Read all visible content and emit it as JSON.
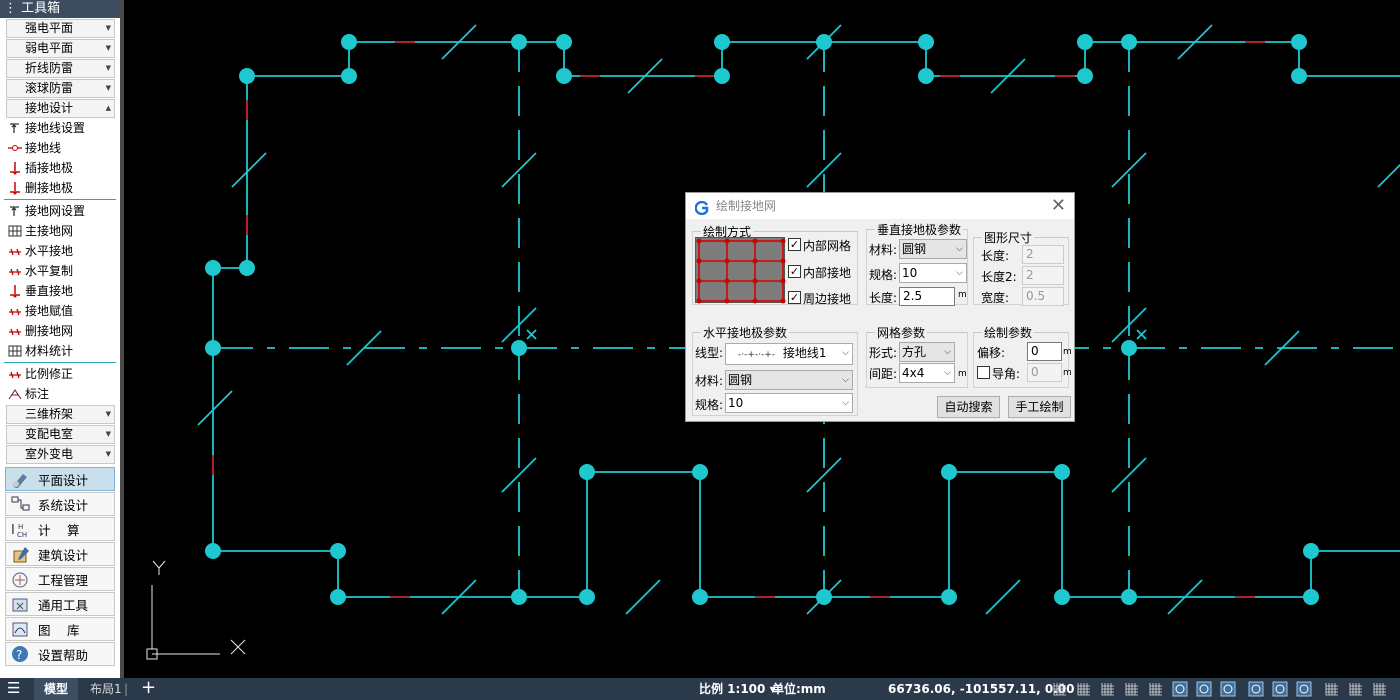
{
  "toolbox": {
    "title": "工具箱",
    "combos": [
      "强电平面",
      "弱电平面",
      "折线防雷",
      "滚球防雷",
      "接地设计"
    ],
    "items1": [
      "接地线设置",
      "接地线",
      "插接地极",
      "删接地极"
    ],
    "items2": [
      "接地网设置",
      "主接地网",
      "水平接地",
      "水平复制",
      "垂直接地",
      "接地赋值",
      "删接地网",
      "材料统计"
    ],
    "items3": [
      "比例修正",
      "标注"
    ],
    "combos2": [
      "三维桥架",
      "变配电室",
      "室外变电"
    ],
    "bigbuttons": [
      "平面设计",
      "系统设计",
      "计　 算",
      "建筑设计",
      "工程管理",
      "通用工具",
      "图　 库",
      "设置帮助"
    ],
    "big_icons": [
      "brush-icon",
      "system-diagram-icon",
      "calculator-icon",
      "building-icon",
      "project-icon",
      "tools-icon",
      "library-icon",
      "help-icon"
    ]
  },
  "dialog": {
    "title": "绘制接地网",
    "draw_mode": {
      "title": "绘制方式",
      "options": [
        {
          "label": "内部网格",
          "checked": true
        },
        {
          "label": "内部接地",
          "checked": true
        },
        {
          "label": "周边接地",
          "checked": true
        }
      ]
    },
    "vertical": {
      "title": "垂直接地极参数",
      "material_label": "材料:",
      "material": "圆钢",
      "spec_label": "规格:",
      "spec": "10",
      "length_label": "长度:",
      "length": "2.5",
      "unit": "m"
    },
    "shape": {
      "title": "图形尺寸",
      "length_label": "长度:",
      "length": "2",
      "length2_label": "长度2:",
      "length2": "2",
      "width_label": "宽度:",
      "width": "0.5"
    },
    "horizontal": {
      "title": "水平接地极参数",
      "linetype_label": "线型:",
      "linetype": "接地线1",
      "linetype_sample": "-·-+-·-+-",
      "material_label": "材料:",
      "material": "圆钢",
      "spec_label": "规格:",
      "spec": "10"
    },
    "grid": {
      "title": "网格参数",
      "shape_label": "形式:",
      "shape": "方孔",
      "spacing_label": "间距:",
      "spacing": "4x4",
      "unit": "m"
    },
    "draw_params": {
      "title": "绘制参数",
      "offset_label": "偏移:",
      "offset": "0",
      "unit": "m",
      "fillet_label": "导角:",
      "fillet": "0",
      "fillet_checked": false
    },
    "buttons": {
      "auto": "自动搜索",
      "manual": "手工绘制"
    }
  },
  "status": {
    "tabs": [
      "模型",
      "布局1"
    ],
    "add": "+",
    "scale": "比例 1:100",
    "unit": "单位:mm",
    "coords": "66736.06, -101557.11, 0.00"
  },
  "ucs": {
    "y": "Y",
    "x": "X"
  },
  "colors": {
    "cad_bg": "#000000",
    "cyan": "#1fc8cf",
    "red": "#c0141b",
    "panel": "#ffffff",
    "status": "#2b3a4b"
  }
}
